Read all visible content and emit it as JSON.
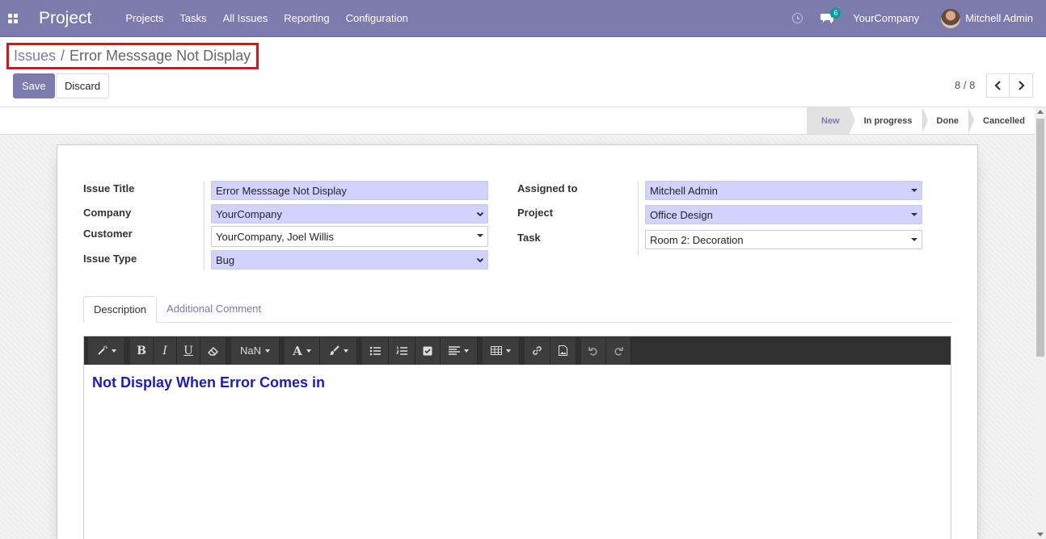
{
  "navbar": {
    "app_title": "Project",
    "menu": [
      "Projects",
      "Tasks",
      "All Issues",
      "Reporting",
      "Configuration"
    ],
    "messages_count": "6",
    "company": "YourCompany",
    "user": "Mitchell Admin"
  },
  "breadcrumb": {
    "parent": "Issues",
    "separator": "/",
    "current": "Error Messsage Not Display"
  },
  "buttons": {
    "save": "Save",
    "discard": "Discard"
  },
  "pager": {
    "value": "8 / 8"
  },
  "stages": {
    "items": [
      "New",
      "In progress",
      "Done",
      "Cancelled"
    ],
    "active": "New"
  },
  "form": {
    "labels": {
      "issue_title": "Issue Title",
      "company": "Company",
      "customer": "Customer",
      "issue_type": "Issue Type",
      "assigned_to": "Assigned to",
      "project": "Project",
      "task": "Task"
    },
    "values": {
      "issue_title": "Error Messsage Not Display",
      "company": "YourCompany",
      "customer": "YourCompany, Joel Willis",
      "issue_type": "Bug",
      "assigned_to": "Mitchell Admin",
      "project": "Office Design",
      "task": "Room 2: Decoration"
    }
  },
  "tabs": [
    "Description",
    "Additional Comment"
  ],
  "editor": {
    "font_size": "NaN",
    "content": "Not Display When Error Comes in"
  },
  "colors": {
    "brand": "#7c7bad",
    "required_field": "#d2d2ff",
    "highlight_border": "#e0101b",
    "heading_text": "#1a1ac8"
  }
}
